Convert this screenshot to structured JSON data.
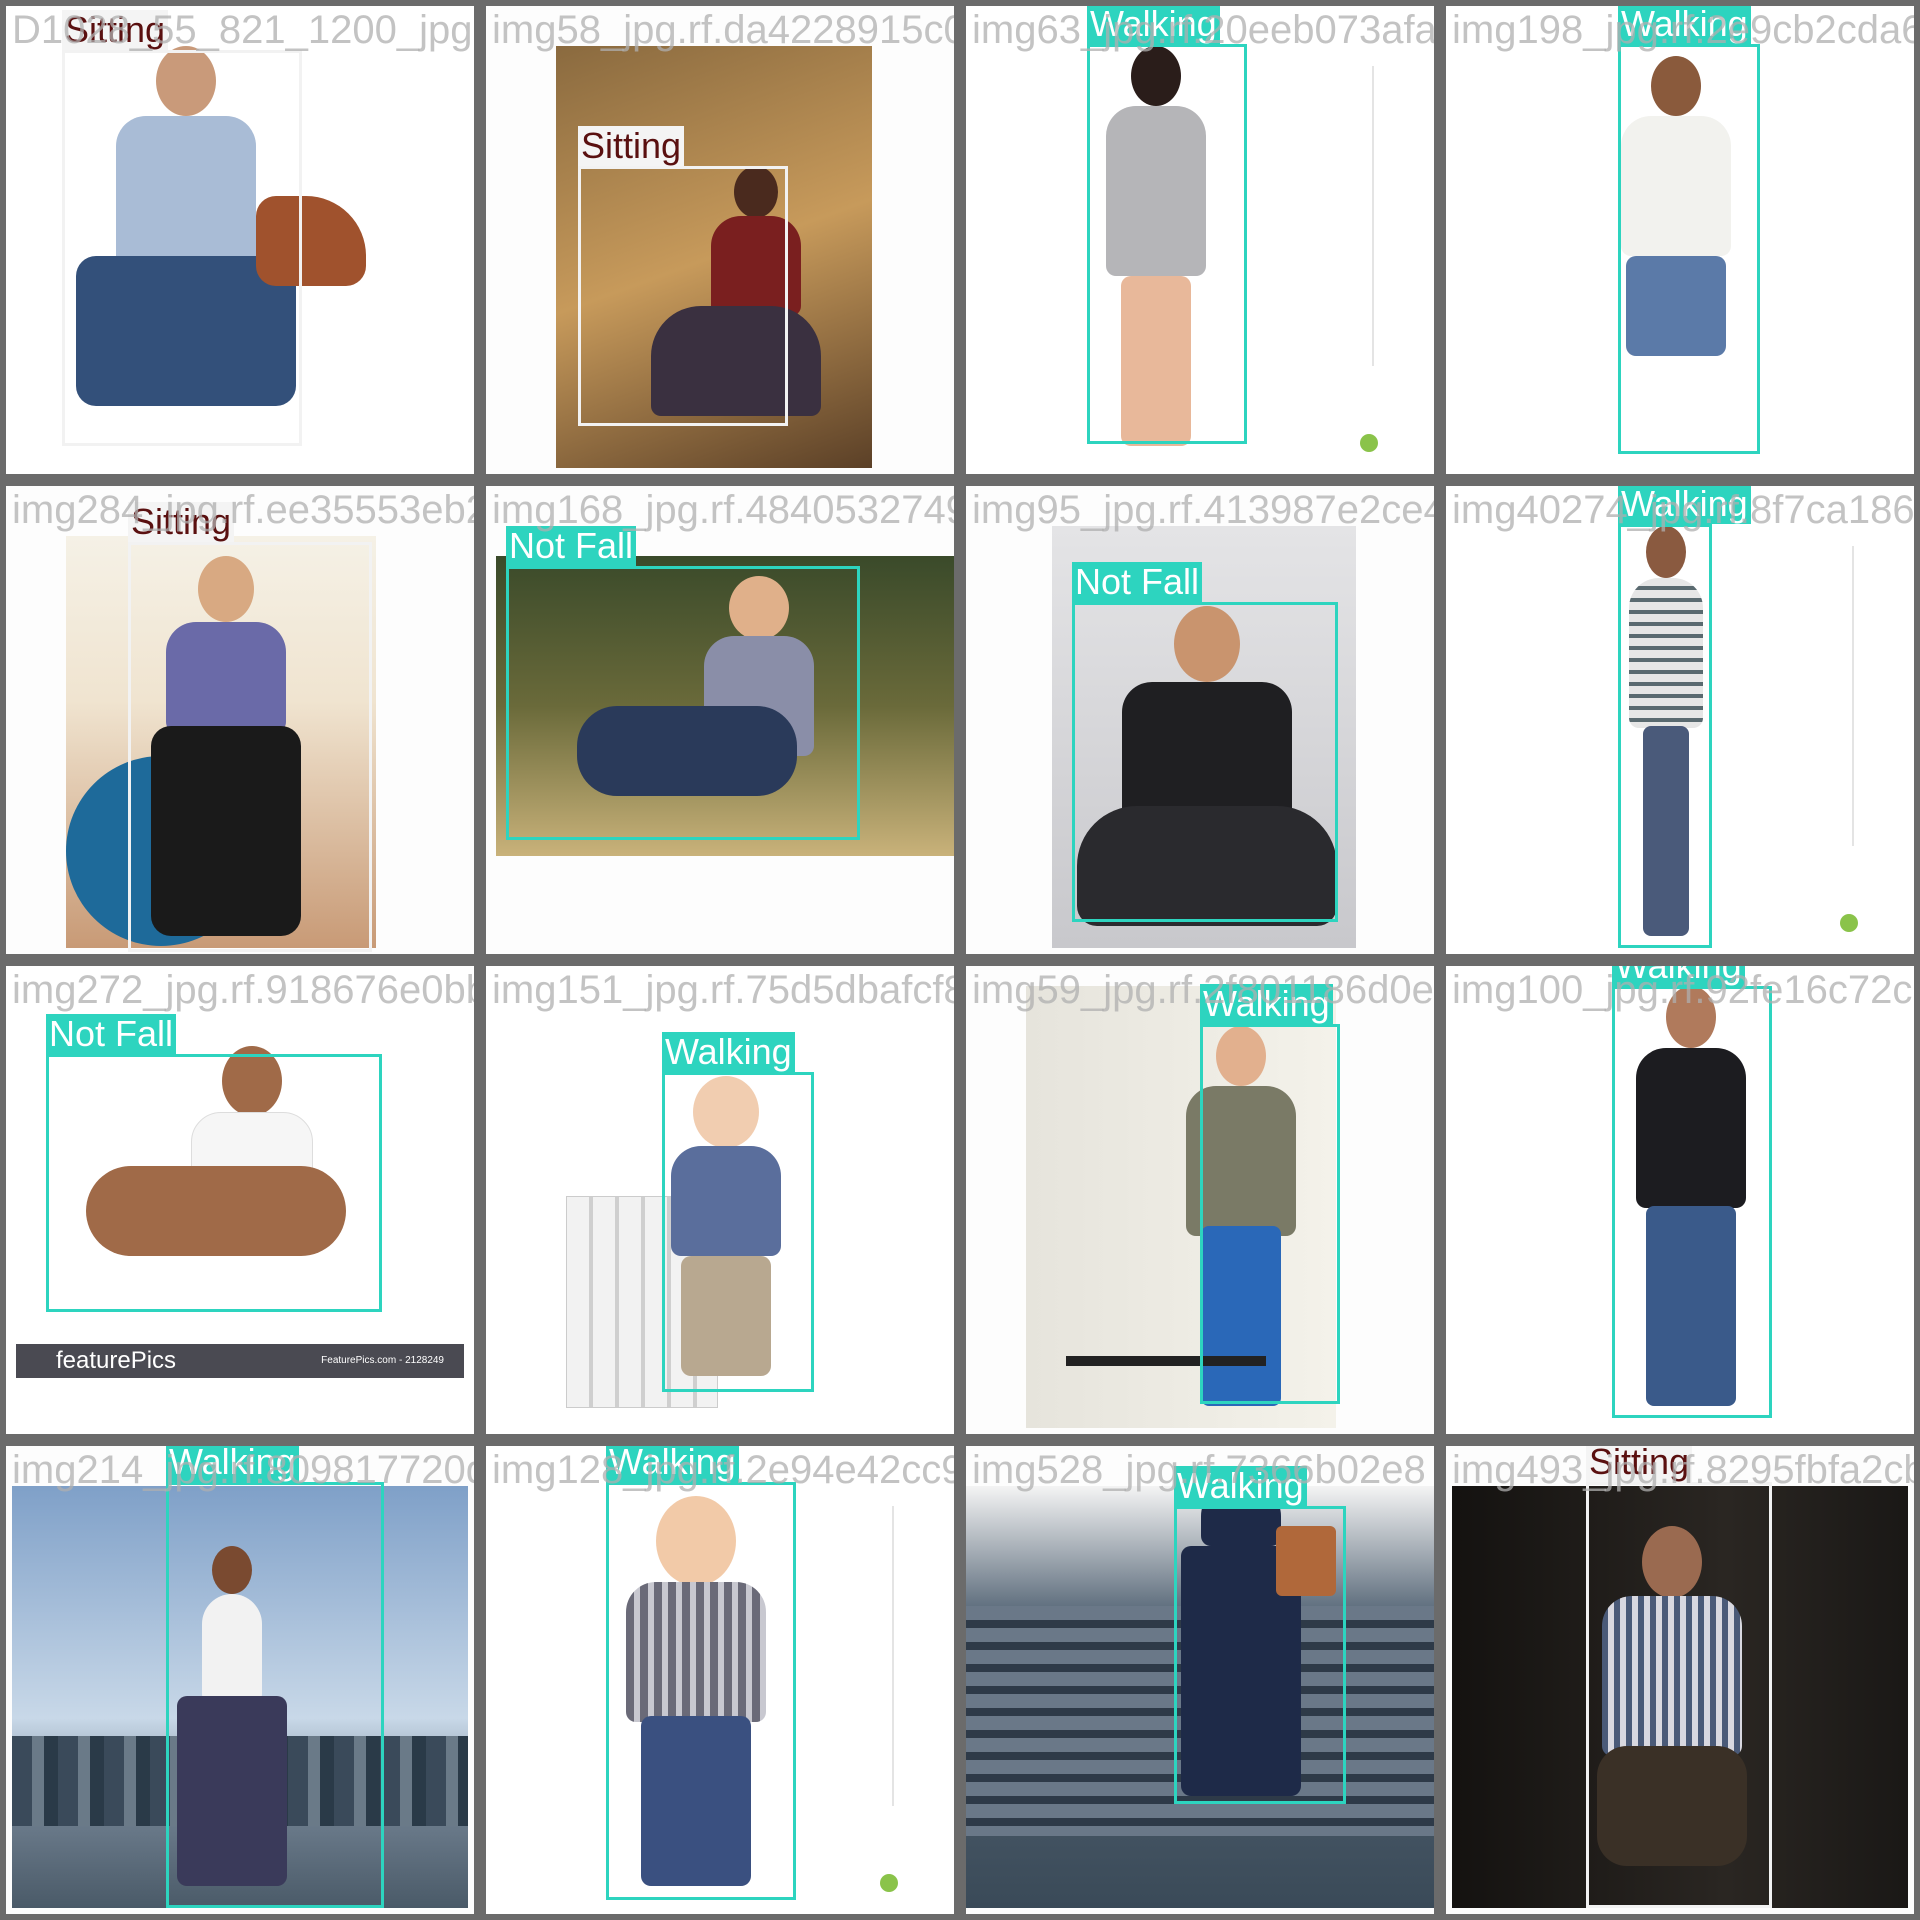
{
  "app": {
    "title": ""
  },
  "tiles": [
    {
      "filename": "D1028_55_821_1200_jpg.rf.2e9168f562c97ba4228915c0af3475",
      "labels": [
        {
          "text": "Sitting",
          "class": "sit"
        }
      ]
    },
    {
      "filename": "img58_jpg.rf.da4228915c0af3475",
      "labels": [
        {
          "text": "Sitting",
          "class": "sit"
        }
      ]
    },
    {
      "filename": "img63_jpg.rf.20eeb073afa741d982",
      "labels": [
        {
          "text": "Walking",
          "class": "walk"
        }
      ]
    },
    {
      "filename": "img198_jpg.rf.2e9cb2cda617b307",
      "labels": [
        {
          "text": "Walking",
          "class": "walk"
        }
      ]
    },
    {
      "filename": "img284_jpg.rf.ee35553eb2c5f1683454b48313",
      "labels": [
        {
          "text": "Sitting",
          "class": "sit"
        }
      ]
    },
    {
      "filename": "img168_jpg.rf.4840532749b3ac29",
      "labels": [
        {
          "text": "Not Fall",
          "class": "notfall"
        }
      ]
    },
    {
      "filename": "img95_jpg.rf.413987e2ce4286b1b3",
      "labels": [
        {
          "text": "Not Fall",
          "class": "notfall"
        }
      ]
    },
    {
      "filename": "img40274_jpg.rf.8f7ca1864",
      "labels": [
        {
          "text": "Walking",
          "class": "walk"
        }
      ]
    },
    {
      "filename": "img272_jpg.rf.918676e0bb5d",
      "labels": [
        {
          "text": "Not Fall",
          "class": "notfall"
        }
      ]
    },
    {
      "filename": "img151_jpg.rf.75d5dbafcf8e2a5ffe",
      "labels": [
        {
          "text": "Walking",
          "class": "walk"
        }
      ]
    },
    {
      "filename": "img59_jpg.rf.2f801186d0e9",
      "labels": [
        {
          "text": "Walking",
          "class": "walk"
        }
      ]
    },
    {
      "filename": "img100_jpg.rf.92fe16c72c",
      "labels": [
        {
          "text": "Walking",
          "class": "walk"
        }
      ]
    },
    {
      "filename": "img214_jpg.rf.809817720db9c",
      "labels": [
        {
          "text": "Walking",
          "class": "walk"
        }
      ]
    },
    {
      "filename": "img128_jpg.rf.2e94e42cc9428",
      "labels": [
        {
          "text": "Walking",
          "class": "walk"
        }
      ]
    },
    {
      "filename": "img528_jpg.rf.7366b02e8",
      "labels": [
        {
          "text": "Walking",
          "class": "walk"
        }
      ]
    },
    {
      "filename": "img493_jpg.rf.8295fbfa2cb7",
      "labels": [
        {
          "text": "Sitting",
          "class": "sit"
        }
      ]
    }
  ],
  "tile4_footer": {
    "brand": "featurePics",
    "credit": "FeaturePics.com - 2128249"
  },
  "colors": {
    "box_walk": "#2dd4bf",
    "box_sit": "#f2f2f2",
    "sit_text": "#5a1010",
    "border": "#6b6b6b"
  }
}
